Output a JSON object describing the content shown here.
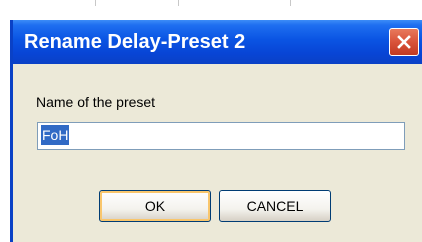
{
  "window": {
    "title": "Rename Delay-Preset 2",
    "close_icon": "close-icon",
    "accent_color": "#0a54e3",
    "close_color": "#d9533a"
  },
  "form": {
    "label": "Name of the preset",
    "input_value": "FoH"
  },
  "buttons": {
    "ok_label": "OK",
    "cancel_label": "CANCEL"
  }
}
